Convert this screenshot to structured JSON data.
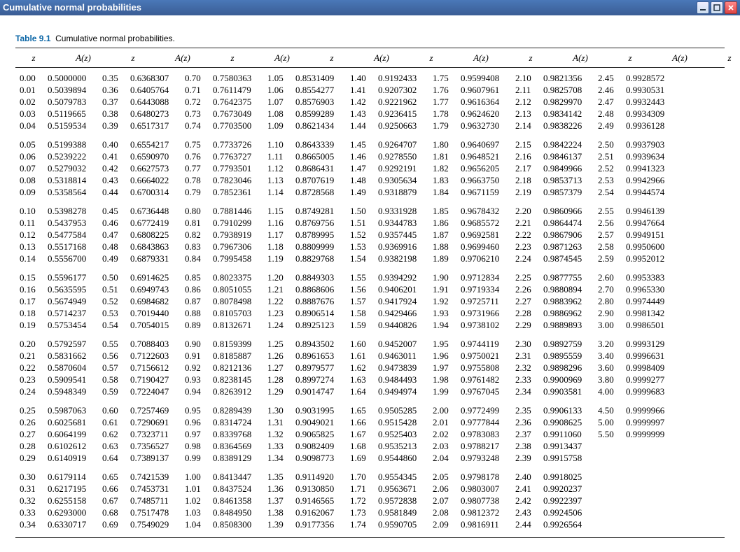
{
  "window": {
    "title": "Cumulative normal probabilities"
  },
  "table": {
    "label": "Table 9.1",
    "caption": "Cumulative normal probabilities.",
    "z_header": "z",
    "a_header": "A(z)",
    "columns": [
      [
        [
          "0.00",
          "0.5000000"
        ],
        [
          "0.01",
          "0.5039894"
        ],
        [
          "0.02",
          "0.5079783"
        ],
        [
          "0.03",
          "0.5119665"
        ],
        [
          "0.04",
          "0.5159534"
        ],
        null,
        [
          "0.05",
          "0.5199388"
        ],
        [
          "0.06",
          "0.5239222"
        ],
        [
          "0.07",
          "0.5279032"
        ],
        [
          "0.08",
          "0.5318814"
        ],
        [
          "0.09",
          "0.5358564"
        ],
        null,
        [
          "0.10",
          "0.5398278"
        ],
        [
          "0.11",
          "0.5437953"
        ],
        [
          "0.12",
          "0.5477584"
        ],
        [
          "0.13",
          "0.5517168"
        ],
        [
          "0.14",
          "0.5556700"
        ],
        null,
        [
          "0.15",
          "0.5596177"
        ],
        [
          "0.16",
          "0.5635595"
        ],
        [
          "0.17",
          "0.5674949"
        ],
        [
          "0.18",
          "0.5714237"
        ],
        [
          "0.19",
          "0.5753454"
        ],
        null,
        [
          "0.20",
          "0.5792597"
        ],
        [
          "0.21",
          "0.5831662"
        ],
        [
          "0.22",
          "0.5870604"
        ],
        [
          "0.23",
          "0.5909541"
        ],
        [
          "0.24",
          "0.5948349"
        ],
        null,
        [
          "0.25",
          "0.5987063"
        ],
        [
          "0.26",
          "0.6025681"
        ],
        [
          "0.27",
          "0.6064199"
        ],
        [
          "0.28",
          "0.6102612"
        ],
        [
          "0.29",
          "0.6140919"
        ],
        null,
        [
          "0.30",
          "0.6179114"
        ],
        [
          "0.31",
          "0.6217195"
        ],
        [
          "0.32",
          "0.6255158"
        ],
        [
          "0.33",
          "0.6293000"
        ],
        [
          "0.34",
          "0.6330717"
        ]
      ],
      [
        [
          "0.35",
          "0.6368307"
        ],
        [
          "0.36",
          "0.6405764"
        ],
        [
          "0.37",
          "0.6443088"
        ],
        [
          "0.38",
          "0.6480273"
        ],
        [
          "0.39",
          "0.6517317"
        ],
        null,
        [
          "0.40",
          "0.6554217"
        ],
        [
          "0.41",
          "0.6590970"
        ],
        [
          "0.42",
          "0.6627573"
        ],
        [
          "0.43",
          "0.6664022"
        ],
        [
          "0.44",
          "0.6700314"
        ],
        null,
        [
          "0.45",
          "0.6736448"
        ],
        [
          "0.46",
          "0.6772419"
        ],
        [
          "0.47",
          "0.6808225"
        ],
        [
          "0.48",
          "0.6843863"
        ],
        [
          "0.49",
          "0.6879331"
        ],
        null,
        [
          "0.50",
          "0.6914625"
        ],
        [
          "0.51",
          "0.6949743"
        ],
        [
          "0.52",
          "0.6984682"
        ],
        [
          "0.53",
          "0.7019440"
        ],
        [
          "0.54",
          "0.7054015"
        ],
        null,
        [
          "0.55",
          "0.7088403"
        ],
        [
          "0.56",
          "0.7122603"
        ],
        [
          "0.57",
          "0.7156612"
        ],
        [
          "0.58",
          "0.7190427"
        ],
        [
          "0.59",
          "0.7224047"
        ],
        null,
        [
          "0.60",
          "0.7257469"
        ],
        [
          "0.61",
          "0.7290691"
        ],
        [
          "0.62",
          "0.7323711"
        ],
        [
          "0.63",
          "0.7356527"
        ],
        [
          "0.64",
          "0.7389137"
        ],
        null,
        [
          "0.65",
          "0.7421539"
        ],
        [
          "0.66",
          "0.7453731"
        ],
        [
          "0.67",
          "0.7485711"
        ],
        [
          "0.68",
          "0.7517478"
        ],
        [
          "0.69",
          "0.7549029"
        ]
      ],
      [
        [
          "0.70",
          "0.7580363"
        ],
        [
          "0.71",
          "0.7611479"
        ],
        [
          "0.72",
          "0.7642375"
        ],
        [
          "0.73",
          "0.7673049"
        ],
        [
          "0.74",
          "0.7703500"
        ],
        null,
        [
          "0.75",
          "0.7733726"
        ],
        [
          "0.76",
          "0.7763727"
        ],
        [
          "0.77",
          "0.7793501"
        ],
        [
          "0.78",
          "0.7823046"
        ],
        [
          "0.79",
          "0.7852361"
        ],
        null,
        [
          "0.80",
          "0.7881446"
        ],
        [
          "0.81",
          "0.7910299"
        ],
        [
          "0.82",
          "0.7938919"
        ],
        [
          "0.83",
          "0.7967306"
        ],
        [
          "0.84",
          "0.7995458"
        ],
        null,
        [
          "0.85",
          "0.8023375"
        ],
        [
          "0.86",
          "0.8051055"
        ],
        [
          "0.87",
          "0.8078498"
        ],
        [
          "0.88",
          "0.8105703"
        ],
        [
          "0.89",
          "0.8132671"
        ],
        null,
        [
          "0.90",
          "0.8159399"
        ],
        [
          "0.91",
          "0.8185887"
        ],
        [
          "0.92",
          "0.8212136"
        ],
        [
          "0.93",
          "0.8238145"
        ],
        [
          "0.94",
          "0.8263912"
        ],
        null,
        [
          "0.95",
          "0.8289439"
        ],
        [
          "0.96",
          "0.8314724"
        ],
        [
          "0.97",
          "0.8339768"
        ],
        [
          "0.98",
          "0.8364569"
        ],
        [
          "0.99",
          "0.8389129"
        ],
        null,
        [
          "1.00",
          "0.8413447"
        ],
        [
          "1.01",
          "0.8437524"
        ],
        [
          "1.02",
          "0.8461358"
        ],
        [
          "1.03",
          "0.8484950"
        ],
        [
          "1.04",
          "0.8508300"
        ]
      ],
      [
        [
          "1.05",
          "0.8531409"
        ],
        [
          "1.06",
          "0.8554277"
        ],
        [
          "1.07",
          "0.8576903"
        ],
        [
          "1.08",
          "0.8599289"
        ],
        [
          "1.09",
          "0.8621434"
        ],
        null,
        [
          "1.10",
          "0.8643339"
        ],
        [
          "1.11",
          "0.8665005"
        ],
        [
          "1.12",
          "0.8686431"
        ],
        [
          "1.13",
          "0.8707619"
        ],
        [
          "1.14",
          "0.8728568"
        ],
        null,
        [
          "1.15",
          "0.8749281"
        ],
        [
          "1.16",
          "0.8769756"
        ],
        [
          "1.17",
          "0.8789995"
        ],
        [
          "1.18",
          "0.8809999"
        ],
        [
          "1.19",
          "0.8829768"
        ],
        null,
        [
          "1.20",
          "0.8849303"
        ],
        [
          "1.21",
          "0.8868606"
        ],
        [
          "1.22",
          "0.8887676"
        ],
        [
          "1.23",
          "0.8906514"
        ],
        [
          "1.24",
          "0.8925123"
        ],
        null,
        [
          "1.25",
          "0.8943502"
        ],
        [
          "1.26",
          "0.8961653"
        ],
        [
          "1.27",
          "0.8979577"
        ],
        [
          "1.28",
          "0.8997274"
        ],
        [
          "1.29",
          "0.9014747"
        ],
        null,
        [
          "1.30",
          "0.9031995"
        ],
        [
          "1.31",
          "0.9049021"
        ],
        [
          "1.32",
          "0.9065825"
        ],
        [
          "1.33",
          "0.9082409"
        ],
        [
          "1.34",
          "0.9098773"
        ],
        null,
        [
          "1.35",
          "0.9114920"
        ],
        [
          "1.36",
          "0.9130850"
        ],
        [
          "1.37",
          "0.9146565"
        ],
        [
          "1.38",
          "0.9162067"
        ],
        [
          "1.39",
          "0.9177356"
        ]
      ],
      [
        [
          "1.40",
          "0.9192433"
        ],
        [
          "1.41",
          "0.9207302"
        ],
        [
          "1.42",
          "0.9221962"
        ],
        [
          "1.43",
          "0.9236415"
        ],
        [
          "1.44",
          "0.9250663"
        ],
        null,
        [
          "1.45",
          "0.9264707"
        ],
        [
          "1.46",
          "0.9278550"
        ],
        [
          "1.47",
          "0.9292191"
        ],
        [
          "1.48",
          "0.9305634"
        ],
        [
          "1.49",
          "0.9318879"
        ],
        null,
        [
          "1.50",
          "0.9331928"
        ],
        [
          "1.51",
          "0.9344783"
        ],
        [
          "1.52",
          "0.9357445"
        ],
        [
          "1.53",
          "0.9369916"
        ],
        [
          "1.54",
          "0.9382198"
        ],
        null,
        [
          "1.55",
          "0.9394292"
        ],
        [
          "1.56",
          "0.9406201"
        ],
        [
          "1.57",
          "0.9417924"
        ],
        [
          "1.58",
          "0.9429466"
        ],
        [
          "1.59",
          "0.9440826"
        ],
        null,
        [
          "1.60",
          "0.9452007"
        ],
        [
          "1.61",
          "0.9463011"
        ],
        [
          "1.62",
          "0.9473839"
        ],
        [
          "1.63",
          "0.9484493"
        ],
        [
          "1.64",
          "0.9494974"
        ],
        null,
        [
          "1.65",
          "0.9505285"
        ],
        [
          "1.66",
          "0.9515428"
        ],
        [
          "1.67",
          "0.9525403"
        ],
        [
          "1.68",
          "0.9535213"
        ],
        [
          "1.69",
          "0.9544860"
        ],
        null,
        [
          "1.70",
          "0.9554345"
        ],
        [
          "1.71",
          "0.9563671"
        ],
        [
          "1.72",
          "0.9572838"
        ],
        [
          "1.73",
          "0.9581849"
        ],
        [
          "1.74",
          "0.9590705"
        ]
      ],
      [
        [
          "1.75",
          "0.9599408"
        ],
        [
          "1.76",
          "0.9607961"
        ],
        [
          "1.77",
          "0.9616364"
        ],
        [
          "1.78",
          "0.9624620"
        ],
        [
          "1.79",
          "0.9632730"
        ],
        null,
        [
          "1.80",
          "0.9640697"
        ],
        [
          "1.81",
          "0.9648521"
        ],
        [
          "1.82",
          "0.9656205"
        ],
        [
          "1.83",
          "0.9663750"
        ],
        [
          "1.84",
          "0.9671159"
        ],
        null,
        [
          "1.85",
          "0.9678432"
        ],
        [
          "1.86",
          "0.9685572"
        ],
        [
          "1.87",
          "0.9692581"
        ],
        [
          "1.88",
          "0.9699460"
        ],
        [
          "1.89",
          "0.9706210"
        ],
        null,
        [
          "1.90",
          "0.9712834"
        ],
        [
          "1.91",
          "0.9719334"
        ],
        [
          "1.92",
          "0.9725711"
        ],
        [
          "1.93",
          "0.9731966"
        ],
        [
          "1.94",
          "0.9738102"
        ],
        null,
        [
          "1.95",
          "0.9744119"
        ],
        [
          "1.96",
          "0.9750021"
        ],
        [
          "1.97",
          "0.9755808"
        ],
        [
          "1.98",
          "0.9761482"
        ],
        [
          "1.99",
          "0.9767045"
        ],
        null,
        [
          "2.00",
          "0.9772499"
        ],
        [
          "2.01",
          "0.9777844"
        ],
        [
          "2.02",
          "0.9783083"
        ],
        [
          "2.03",
          "0.9788217"
        ],
        [
          "2.04",
          "0.9793248"
        ],
        null,
        [
          "2.05",
          "0.9798178"
        ],
        [
          "2.06",
          "0.9803007"
        ],
        [
          "2.07",
          "0.9807738"
        ],
        [
          "2.08",
          "0.9812372"
        ],
        [
          "2.09",
          "0.9816911"
        ]
      ],
      [
        [
          "2.10",
          "0.9821356"
        ],
        [
          "2.11",
          "0.9825708"
        ],
        [
          "2.12",
          "0.9829970"
        ],
        [
          "2.13",
          "0.9834142"
        ],
        [
          "2.14",
          "0.9838226"
        ],
        null,
        [
          "2.15",
          "0.9842224"
        ],
        [
          "2.16",
          "0.9846137"
        ],
        [
          "2.17",
          "0.9849966"
        ],
        [
          "2.18",
          "0.9853713"
        ],
        [
          "2.19",
          "0.9857379"
        ],
        null,
        [
          "2.20",
          "0.9860966"
        ],
        [
          "2.21",
          "0.9864474"
        ],
        [
          "2.22",
          "0.9867906"
        ],
        [
          "2.23",
          "0.9871263"
        ],
        [
          "2.24",
          "0.9874545"
        ],
        null,
        [
          "2.25",
          "0.9877755"
        ],
        [
          "2.26",
          "0.9880894"
        ],
        [
          "2.27",
          "0.9883962"
        ],
        [
          "2.28",
          "0.9886962"
        ],
        [
          "2.29",
          "0.9889893"
        ],
        null,
        [
          "2.30",
          "0.9892759"
        ],
        [
          "2.31",
          "0.9895559"
        ],
        [
          "2.32",
          "0.9898296"
        ],
        [
          "2.33",
          "0.9900969"
        ],
        [
          "2.34",
          "0.9903581"
        ],
        null,
        [
          "2.35",
          "0.9906133"
        ],
        [
          "2.36",
          "0.9908625"
        ],
        [
          "2.37",
          "0.9911060"
        ],
        [
          "2.38",
          "0.9913437"
        ],
        [
          "2.39",
          "0.9915758"
        ],
        null,
        [
          "2.40",
          "0.9918025"
        ],
        [
          "2.41",
          "0.9920237"
        ],
        [
          "2.42",
          "0.9922397"
        ],
        [
          "2.43",
          "0.9924506"
        ],
        [
          "2.44",
          "0.9926564"
        ]
      ],
      [
        [
          "2.45",
          "0.9928572"
        ],
        [
          "2.46",
          "0.9930531"
        ],
        [
          "2.47",
          "0.9932443"
        ],
        [
          "2.48",
          "0.9934309"
        ],
        [
          "2.49",
          "0.9936128"
        ],
        null,
        [
          "2.50",
          "0.9937903"
        ],
        [
          "2.51",
          "0.9939634"
        ],
        [
          "2.52",
          "0.9941323"
        ],
        [
          "2.53",
          "0.9942966"
        ],
        [
          "2.54",
          "0.9944574"
        ],
        null,
        [
          "2.55",
          "0.9946139"
        ],
        [
          "2.56",
          "0.9947664"
        ],
        [
          "2.57",
          "0.9949151"
        ],
        [
          "2.58",
          "0.9950600"
        ],
        [
          "2.59",
          "0.9952012"
        ],
        null,
        [
          "2.60",
          "0.9953383"
        ],
        [
          "2.70",
          "0.9965330"
        ],
        [
          "2.80",
          "0.9974449"
        ],
        [
          "2.90",
          "0.9981342"
        ],
        [
          "3.00",
          "0.9986501"
        ],
        null,
        [
          "3.20",
          "0.9993129"
        ],
        [
          "3.40",
          "0.9996631"
        ],
        [
          "3.60",
          "0.9998409"
        ],
        [
          "3.80",
          "0.9999277"
        ],
        [
          "4.00",
          "0.9999683"
        ],
        null,
        [
          "4.50",
          "0.9999966"
        ],
        [
          "5.00",
          "0.9999997"
        ],
        [
          "5.50",
          "0.9999999"
        ]
      ]
    ]
  }
}
